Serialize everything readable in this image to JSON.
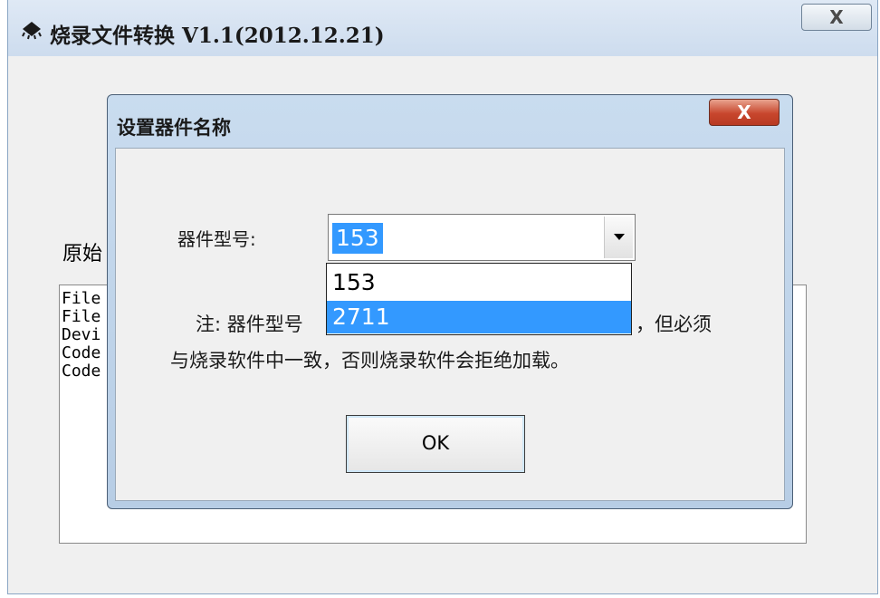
{
  "main_window": {
    "title": "烧录文件转换 V1.1(2012.12.21)",
    "close_glyph": "X",
    "original_label": "原始",
    "info_lines": [
      "File",
      "File",
      "Devi",
      "Code",
      "Code"
    ]
  },
  "dialog": {
    "title": "设置器件名称",
    "close_glyph": "X",
    "field_label": "器件型号:",
    "combo_value": "153",
    "note_line1": "注: 器件型号",
    "note_line1_tail": "，但必须",
    "note_line2": "与烧录软件中一致，否则烧录软件会拒绝加载。",
    "ok_label": "OK"
  },
  "dropdown": {
    "options": [
      "153",
      "2711"
    ],
    "highlighted": "2711"
  },
  "colors": {
    "selection": "#3399ff",
    "dialog_frame": "#b7cde5",
    "close_red": "#c8462d"
  },
  "icons": {
    "app": "chip-icon",
    "combo_arrow": "chevron-down-icon"
  }
}
